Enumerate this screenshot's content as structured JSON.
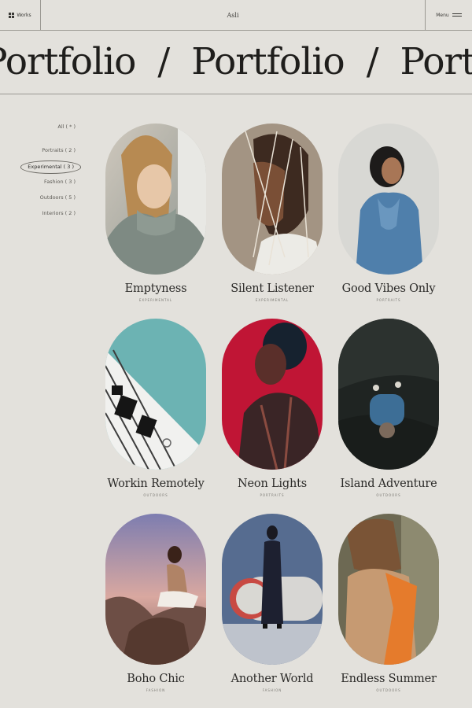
{
  "header": {
    "works_label": "Works",
    "brand": "Asli",
    "menu_label": "Menu"
  },
  "marquee": {
    "word": "Portfolio",
    "separator": "/",
    "visible_text": "ortfolio / Portfolio / Portfolio"
  },
  "filters": [
    {
      "label": "All ( * )",
      "active": false
    },
    {
      "label": "Portraits ( 2 )",
      "active": false
    },
    {
      "label": "Experimental ( 3 )",
      "active": true
    },
    {
      "label": "Fashion ( 3 )",
      "active": false
    },
    {
      "label": "Outdoors ( 5 )",
      "active": false
    },
    {
      "label": "Interiors ( 2 )",
      "active": false
    }
  ],
  "projects": [
    {
      "title": "Emptyness",
      "category": "Experimental"
    },
    {
      "title": "Silent Listener",
      "category": "Experimental"
    },
    {
      "title": "Good Vibes Only",
      "category": "Portraits"
    },
    {
      "title": "Workin Remotely",
      "category": "Outdoors"
    },
    {
      "title": "Neon Lights",
      "category": "Portraits"
    },
    {
      "title": "Island Adventure",
      "category": "Outdoors"
    },
    {
      "title": "Boho Chic",
      "category": "Fashion"
    },
    {
      "title": "Another World",
      "category": "Fashion"
    },
    {
      "title": "Endless Summer",
      "category": "Outdoors"
    }
  ],
  "colors": {
    "background": "#e3e1dc",
    "text": "#2b2a28",
    "rule": "#9b9993"
  }
}
